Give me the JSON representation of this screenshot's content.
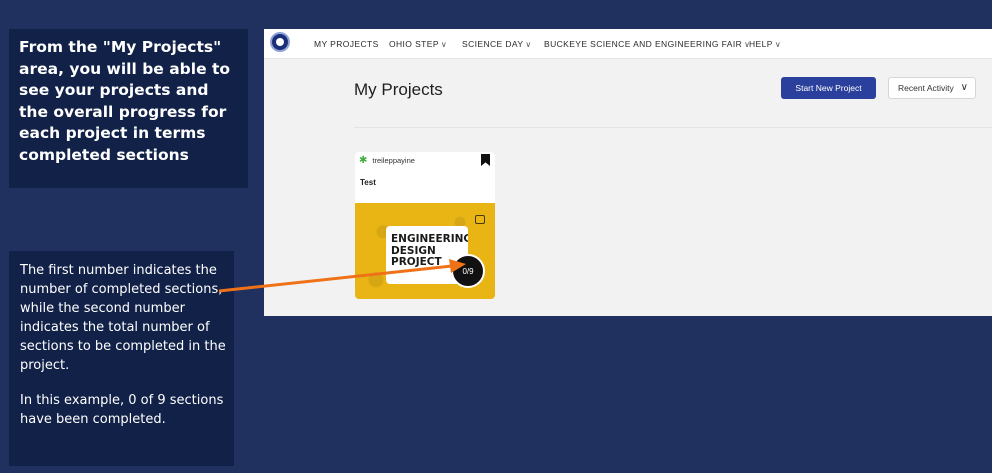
{
  "callouts": {
    "top": "From the \"My Projects\" area, you will be able to see your projects and the overall progress for each project in terms completed sections",
    "bottom_p1": "The first number indicates the number of completed sections, while the second number indicates the total number of sections to be completed in the project.",
    "bottom_p2": "In this example, 0 of 9 sections have been completed."
  },
  "nav": {
    "items": [
      {
        "label": "MY PROJECTS",
        "has_dropdown": false
      },
      {
        "label": "OHIO STEP",
        "has_dropdown": true
      },
      {
        "label": "SCIENCE DAY",
        "has_dropdown": true
      },
      {
        "label": "BUCKEYE SCIENCE AND ENGINEERING FAIR",
        "has_dropdown": true
      },
      {
        "label": "HELP",
        "has_dropdown": true
      }
    ],
    "chevron": "∨"
  },
  "page": {
    "title": "My Projects",
    "new_button": "Start New Project",
    "sort_value": "Recent Activity",
    "sort_chevron": "∨"
  },
  "card": {
    "user": "treileppayine",
    "user_icon": "✱",
    "title": "Test",
    "image_label_line1": "ENGINEERING",
    "image_label_line2": "DESIGN",
    "image_label_line3": "PROJECT",
    "progress": "0/9",
    "progress_completed": 0,
    "progress_total": 9
  },
  "colors": {
    "background": "#20305f",
    "callout_bg": "#112148",
    "accent_button": "#2b3f9c",
    "card_image": "#e8b515",
    "arrow": "#f07218"
  }
}
